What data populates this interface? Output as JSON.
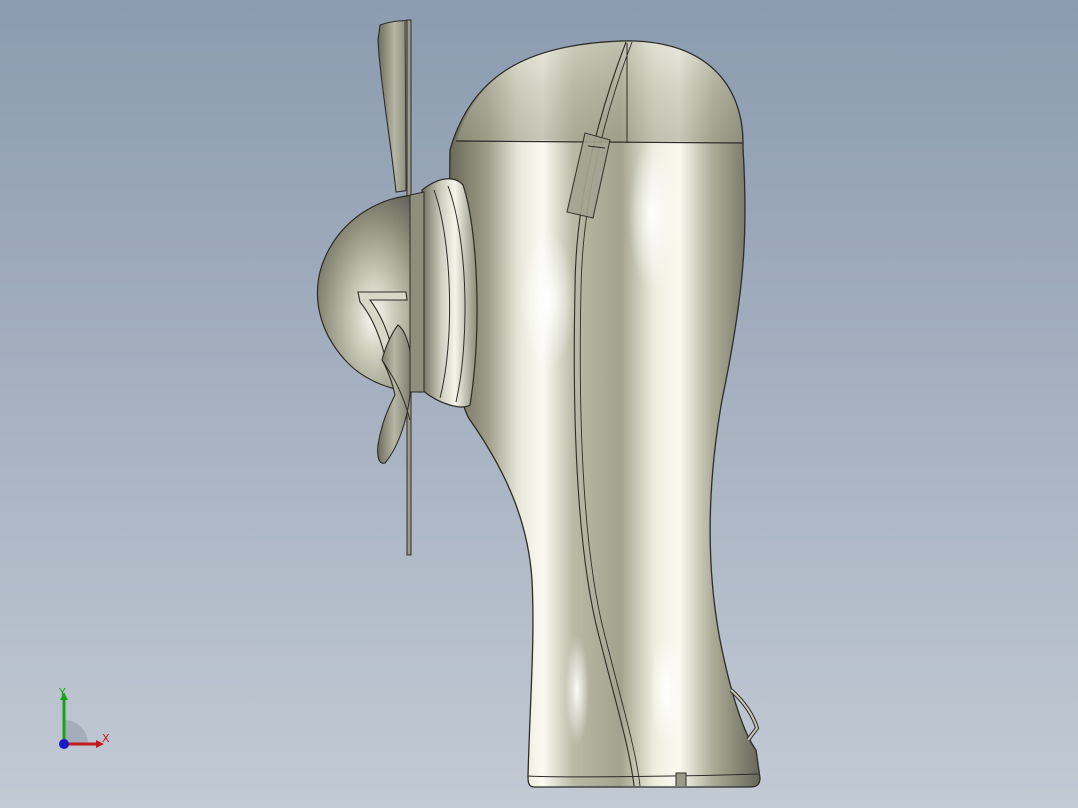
{
  "viewport": {
    "background_top": "#8c9bb0",
    "background_bottom": "#c2cad4",
    "model_color": "#a8a89a",
    "edge_color": "#2c2c28"
  },
  "triad": {
    "x_label": "X",
    "y_label": "Y",
    "x_color": "#c41a1a",
    "y_color": "#1aa31a",
    "z_color": "#1a1ac4"
  }
}
